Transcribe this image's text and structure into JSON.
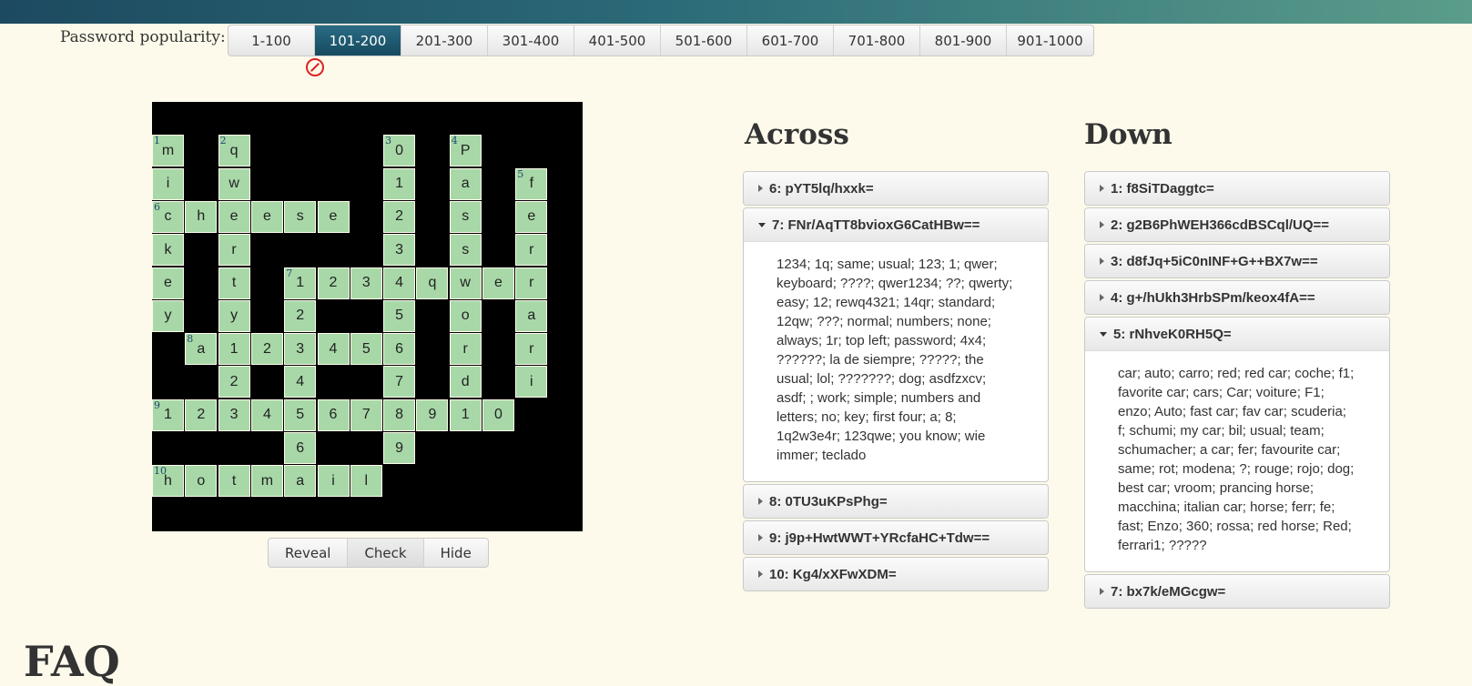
{
  "popularity_label": "Password popularity:",
  "tabs": [
    {
      "label": "1-100",
      "active": false
    },
    {
      "label": "101-200",
      "active": true
    },
    {
      "label": "201-300",
      "active": false
    },
    {
      "label": "301-400",
      "active": false
    },
    {
      "label": "401-500",
      "active": false
    },
    {
      "label": "501-600",
      "active": false
    },
    {
      "label": "601-700",
      "active": false
    },
    {
      "label": "701-800",
      "active": false
    },
    {
      "label": "801-900",
      "active": false
    },
    {
      "label": "901-1000",
      "active": false
    }
  ],
  "status_icon": "no-entry-icon",
  "grid": {
    "rows": 13,
    "cols": 13,
    "cells": [
      {
        "r": 1,
        "c": 0,
        "ch": "m",
        "n": "1"
      },
      {
        "r": 1,
        "c": 2,
        "ch": "q",
        "n": "2"
      },
      {
        "r": 1,
        "c": 7,
        "ch": "0",
        "n": "3"
      },
      {
        "r": 1,
        "c": 9,
        "ch": "P",
        "n": "4"
      },
      {
        "r": 2,
        "c": 0,
        "ch": "i"
      },
      {
        "r": 2,
        "c": 2,
        "ch": "w"
      },
      {
        "r": 2,
        "c": 7,
        "ch": "1"
      },
      {
        "r": 2,
        "c": 9,
        "ch": "a"
      },
      {
        "r": 2,
        "c": 11,
        "ch": "f",
        "n": "5"
      },
      {
        "r": 3,
        "c": 0,
        "ch": "c",
        "n": "6"
      },
      {
        "r": 3,
        "c": 1,
        "ch": "h"
      },
      {
        "r": 3,
        "c": 2,
        "ch": "e"
      },
      {
        "r": 3,
        "c": 3,
        "ch": "e"
      },
      {
        "r": 3,
        "c": 4,
        "ch": "s"
      },
      {
        "r": 3,
        "c": 5,
        "ch": "e"
      },
      {
        "r": 3,
        "c": 7,
        "ch": "2"
      },
      {
        "r": 3,
        "c": 9,
        "ch": "s"
      },
      {
        "r": 3,
        "c": 11,
        "ch": "e"
      },
      {
        "r": 4,
        "c": 0,
        "ch": "k"
      },
      {
        "r": 4,
        "c": 2,
        "ch": "r"
      },
      {
        "r": 4,
        "c": 7,
        "ch": "3"
      },
      {
        "r": 4,
        "c": 9,
        "ch": "s"
      },
      {
        "r": 4,
        "c": 11,
        "ch": "r"
      },
      {
        "r": 5,
        "c": 0,
        "ch": "e"
      },
      {
        "r": 5,
        "c": 2,
        "ch": "t"
      },
      {
        "r": 5,
        "c": 4,
        "ch": "1",
        "n": "7"
      },
      {
        "r": 5,
        "c": 5,
        "ch": "2"
      },
      {
        "r": 5,
        "c": 6,
        "ch": "3"
      },
      {
        "r": 5,
        "c": 7,
        "ch": "4"
      },
      {
        "r": 5,
        "c": 8,
        "ch": "q"
      },
      {
        "r": 5,
        "c": 9,
        "ch": "w"
      },
      {
        "r": 5,
        "c": 10,
        "ch": "e"
      },
      {
        "r": 5,
        "c": 11,
        "ch": "r"
      },
      {
        "r": 6,
        "c": 0,
        "ch": "y"
      },
      {
        "r": 6,
        "c": 2,
        "ch": "y"
      },
      {
        "r": 6,
        "c": 4,
        "ch": "2"
      },
      {
        "r": 6,
        "c": 7,
        "ch": "5"
      },
      {
        "r": 6,
        "c": 9,
        "ch": "o"
      },
      {
        "r": 6,
        "c": 11,
        "ch": "a"
      },
      {
        "r": 7,
        "c": 1,
        "ch": "a",
        "n": "8"
      },
      {
        "r": 7,
        "c": 2,
        "ch": "1"
      },
      {
        "r": 7,
        "c": 3,
        "ch": "2"
      },
      {
        "r": 7,
        "c": 4,
        "ch": "3"
      },
      {
        "r": 7,
        "c": 5,
        "ch": "4"
      },
      {
        "r": 7,
        "c": 6,
        "ch": "5"
      },
      {
        "r": 7,
        "c": 7,
        "ch": "6"
      },
      {
        "r": 7,
        "c": 9,
        "ch": "r"
      },
      {
        "r": 7,
        "c": 11,
        "ch": "r"
      },
      {
        "r": 8,
        "c": 2,
        "ch": "2"
      },
      {
        "r": 8,
        "c": 4,
        "ch": "4"
      },
      {
        "r": 8,
        "c": 7,
        "ch": "7"
      },
      {
        "r": 8,
        "c": 9,
        "ch": "d"
      },
      {
        "r": 8,
        "c": 11,
        "ch": "i"
      },
      {
        "r": 9,
        "c": 0,
        "ch": "1",
        "n": "9"
      },
      {
        "r": 9,
        "c": 1,
        "ch": "2"
      },
      {
        "r": 9,
        "c": 2,
        "ch": "3"
      },
      {
        "r": 9,
        "c": 3,
        "ch": "4"
      },
      {
        "r": 9,
        "c": 4,
        "ch": "5"
      },
      {
        "r": 9,
        "c": 5,
        "ch": "6"
      },
      {
        "r": 9,
        "c": 6,
        "ch": "7"
      },
      {
        "r": 9,
        "c": 7,
        "ch": "8"
      },
      {
        "r": 9,
        "c": 8,
        "ch": "9"
      },
      {
        "r": 9,
        "c": 9,
        "ch": "1"
      },
      {
        "r": 9,
        "c": 10,
        "ch": "0"
      },
      {
        "r": 10,
        "c": 4,
        "ch": "6"
      },
      {
        "r": 10,
        "c": 7,
        "ch": "9"
      },
      {
        "r": 11,
        "c": 0,
        "ch": "h",
        "n": "10"
      },
      {
        "r": 11,
        "c": 1,
        "ch": "o"
      },
      {
        "r": 11,
        "c": 2,
        "ch": "t"
      },
      {
        "r": 11,
        "c": 3,
        "ch": "m"
      },
      {
        "r": 11,
        "c": 4,
        "ch": "a"
      },
      {
        "r": 11,
        "c": 5,
        "ch": "i"
      },
      {
        "r": 11,
        "c": 6,
        "ch": "l"
      }
    ]
  },
  "buttons": {
    "reveal": "Reveal",
    "check": "Check",
    "hide": "Hide"
  },
  "across": {
    "title": "Across",
    "clues": [
      {
        "label": "6: pYT5lq/hxxk=",
        "expanded": false,
        "body": ""
      },
      {
        "label": "7: FNr/AqTT8bvioxG6CatHBw==",
        "expanded": true,
        "body": "1234; 1q; same; usual; 123; 1; qwer; keyboard; ????; qwer1234; ??; qwerty; easy; 12; rewq4321; 14qr; standard; 12qw; ???; normal; numbers; none; always; 1r; top left; password; 4x4; ??????; la de siempre; ?????; the usual; lol; ???????; dog; asdfzxcv; asdf; ; work; simple; numbers and letters; no; key; first four; a; 8; 1q2w3e4r; 123qwe; you know; wie immer; teclado"
      },
      {
        "label": "8: 0TU3uKPsPhg=",
        "expanded": false,
        "body": ""
      },
      {
        "label": "9: j9p+HwtWWT+YRcfaHC+Tdw==",
        "expanded": false,
        "body": ""
      },
      {
        "label": "10: Kg4/xXFwXDM=",
        "expanded": false,
        "body": ""
      }
    ]
  },
  "down": {
    "title": "Down",
    "clues": [
      {
        "label": "1: f8SiTDaggtc=",
        "expanded": false,
        "body": ""
      },
      {
        "label": "2: g2B6PhWEH366cdBSCql/UQ==",
        "expanded": false,
        "body": ""
      },
      {
        "label": "3: d8fJq+5iC0nINF+G++BX7w==",
        "expanded": false,
        "body": ""
      },
      {
        "label": "4: g+/hUkh3HrbSPm/keox4fA==",
        "expanded": false,
        "body": ""
      },
      {
        "label": "5: rNhveK0RH5Q=",
        "expanded": true,
        "body": "car; auto; carro; red; red car; coche; f1; favorite car; cars; Car; voiture; F1; enzo; Auto; fast car; fav car; scuderia; f; schumi; my car; bil; usual; team; schumacher; a car; fer; favourite car; same; rot; modena; ?; rouge; rojo; dog; best car; vroom; prancing horse; macchina; italian car; horse; ferr; fe; fast; Enzo; 360; rossa; red horse; Red; ferrari1; ?????"
      },
      {
        "label": "7: bx7k/eMGcgw=",
        "expanded": false,
        "body": ""
      }
    ]
  },
  "faq_heading": "FAQ"
}
